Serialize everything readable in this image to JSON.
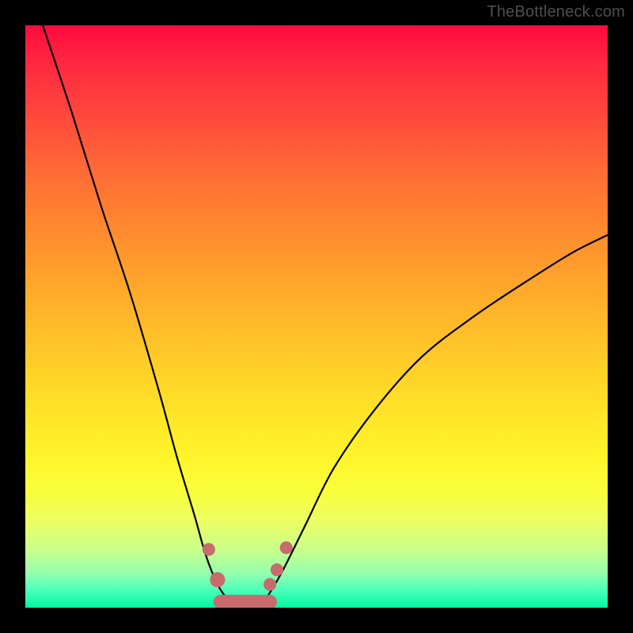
{
  "watermark": "TheBottleneck.com",
  "colors": {
    "page_bg": "#000000",
    "watermark": "#4f4f4f",
    "curve": "#000000",
    "markers": "#c76b6c",
    "gradient_top": "#ff0a3d",
    "gradient_bottom": "#00f7a0"
  },
  "chart_data": {
    "type": "line",
    "title": "",
    "xlabel": "",
    "ylabel": "",
    "xlim": [
      0,
      100
    ],
    "ylim": [
      0,
      100
    ],
    "note": "Axes are unlabeled in the image. x spans the plot width left→right; y is bottleneck-like quantity with 0 at the bottom (green) and 100 at the top (red). Values read from pixel positions.",
    "series": [
      {
        "name": "left-branch",
        "x": [
          3,
          8,
          13,
          18,
          23,
          26,
          29,
          31,
          33,
          35
        ],
        "y": [
          100,
          85,
          69,
          54,
          37,
          26,
          16,
          9,
          4,
          1
        ]
      },
      {
        "name": "right-branch",
        "x": [
          41,
          44,
          48,
          53,
          60,
          68,
          77,
          86,
          94,
          100
        ],
        "y": [
          1,
          6,
          14,
          24,
          34,
          43,
          50,
          56,
          61,
          64
        ]
      },
      {
        "name": "valley-floor",
        "x": [
          35,
          36.5,
          38,
          39.5,
          41
        ],
        "y": [
          1,
          0.3,
          0.2,
          0.3,
          1
        ]
      }
    ],
    "markers": {
      "name": "highlighted-points",
      "color": "#c76b6c",
      "points": [
        {
          "x": 31.5,
          "y": 10,
          "r": 1.1
        },
        {
          "x": 33.0,
          "y": 4.8,
          "r": 1.3
        },
        {
          "x": 42.0,
          "y": 4.0,
          "r": 1.1
        },
        {
          "x": 43.2,
          "y": 6.5,
          "r": 1.1
        },
        {
          "x": 44.8,
          "y": 10.3,
          "r": 1.1
        }
      ],
      "valley_band": {
        "x0": 33.5,
        "x1": 42.0,
        "y": 1.0,
        "thickness": 2.4
      }
    }
  }
}
